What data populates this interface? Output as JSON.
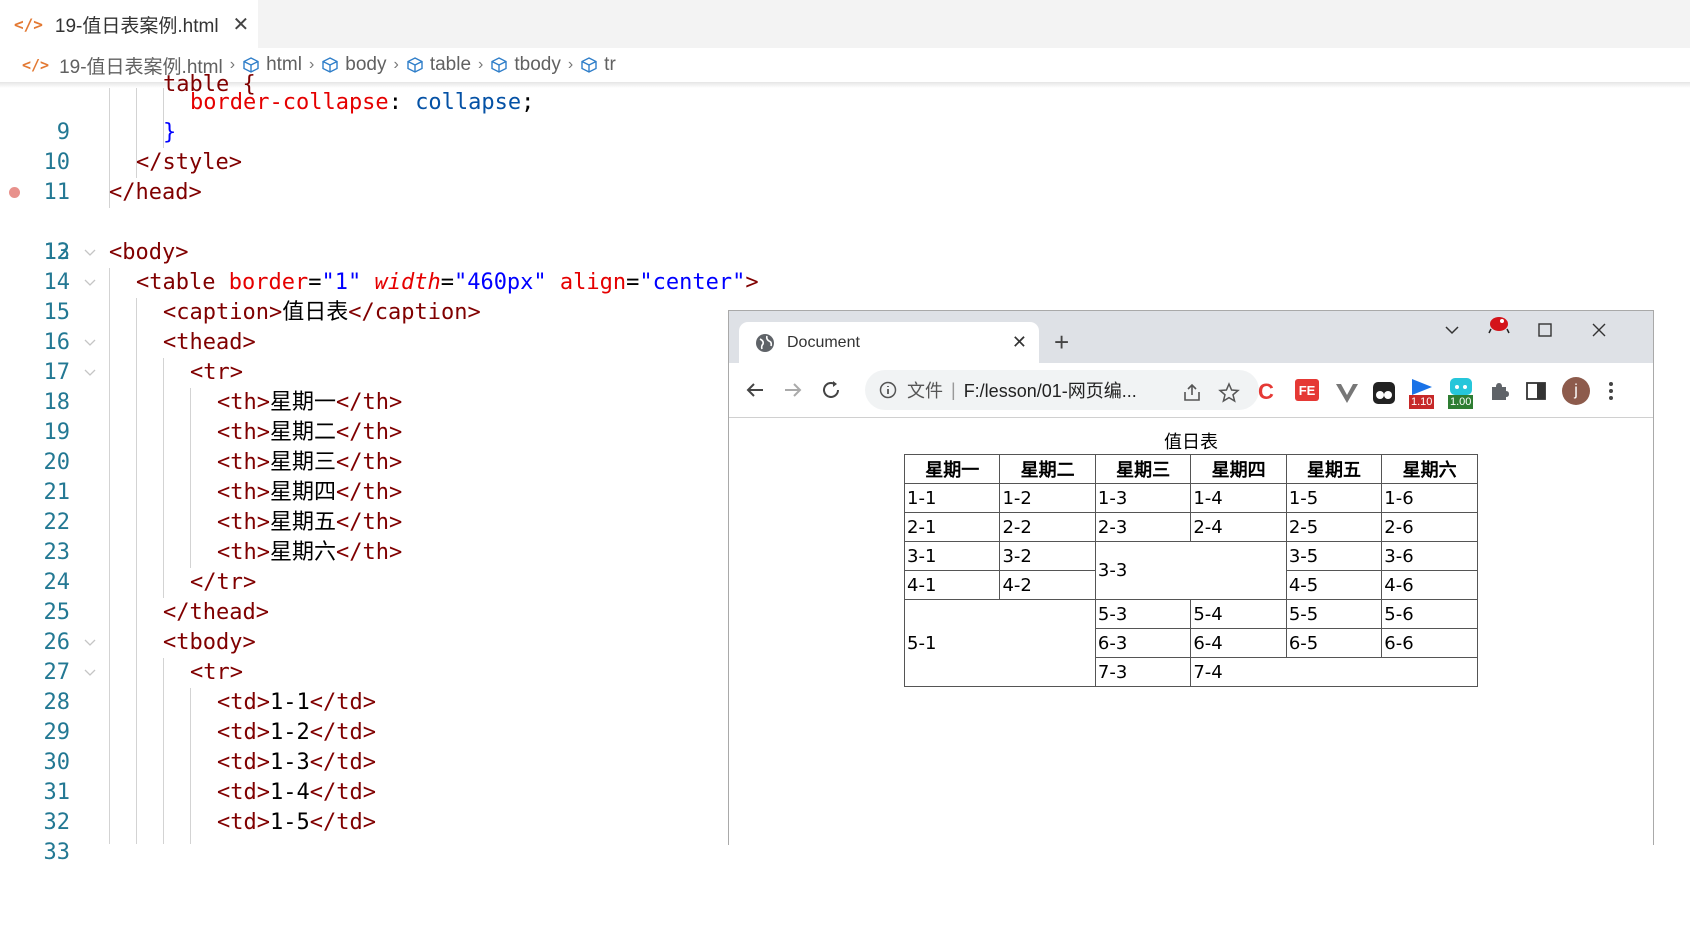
{
  "editor": {
    "tab": {
      "title": "19-值日表案例.html",
      "icon": "html-file-icon"
    },
    "breadcrumb": [
      "19-值日表案例.html",
      "html",
      "body",
      "table",
      "tbody",
      "tr"
    ],
    "gutter_numbers": [
      "9",
      "10",
      "11",
      "12",
      "13",
      "14",
      "15",
      "16",
      "17",
      "18",
      "19",
      "20",
      "21",
      "22",
      "23",
      "24",
      "25",
      "26",
      "27",
      "28",
      "29",
      "30",
      "31",
      "32",
      "33"
    ],
    "code": {
      "l9_prop": "border-collapse",
      "l9_colon": ": ",
      "l9_val": "collapse",
      "l9_semi": ";",
      "l10": "}",
      "l11": "</style>",
      "l12": "</head>",
      "l14": "<body>",
      "l15_open": "<table",
      "l15_a1": "border",
      "l15_eq": "=",
      "l15_v1": "\"1\"",
      "l15_a2": "width",
      "l15_v2": "\"460px\"",
      "l15_a3": "align",
      "l15_v3": "\"center\"",
      "l15_close": ">",
      "l16_open": "<caption>",
      "l16_text": "值日表",
      "l16_close": "</caption>",
      "l17": "<thead>",
      "l18": "<tr>",
      "th_open": "<th>",
      "th_close": "</th>",
      "th_texts": [
        "星期一",
        "星期二",
        "星期三",
        "星期四",
        "星期五",
        "星期六"
      ],
      "l25": "</tr>",
      "l26": "</thead>",
      "l27": "<tbody>",
      "l28": "<tr>",
      "td_open": "<td>",
      "td_close": "</td>",
      "td_texts": [
        "1-1",
        "1-2",
        "1-3",
        "1-4",
        "1-5"
      ]
    }
  },
  "browser": {
    "tab_title": "Document",
    "new_tab": "+",
    "omnibox": {
      "scheme": "文件",
      "pipe": "|",
      "url": "F:/lesson/01-网页编..."
    },
    "extensions": [
      {
        "name": "c-extension-icon",
        "label": "C"
      },
      {
        "name": "fe-extension-icon",
        "label": "FE"
      },
      {
        "name": "vue-devtools-icon",
        "label": ""
      },
      {
        "name": "tampermonkey-icon",
        "label": ""
      },
      {
        "name": "extension-1-10-icon",
        "badge": "1.10"
      },
      {
        "name": "extension-1-00-icon",
        "badge": "1.00"
      }
    ],
    "profile_initial": "j",
    "page": {
      "caption": "值日表",
      "headers": [
        "星期一",
        "星期二",
        "星期三",
        "星期四",
        "星期五",
        "星期六"
      ],
      "r1": [
        "1-1",
        "1-2",
        "1-3",
        "1-4",
        "1-5",
        "1-6"
      ],
      "r2": [
        "2-1",
        "2-2",
        "2-3",
        "2-4",
        "2-5",
        "2-6"
      ],
      "r3": [
        "3-1",
        "3-2",
        "3-3",
        "3-5",
        "3-6"
      ],
      "r4": [
        "4-1",
        "4-2",
        "4-5",
        "4-6"
      ],
      "r5": [
        "5-1",
        "5-3",
        "5-4",
        "5-5",
        "5-6"
      ],
      "r6": [
        "6-3",
        "6-4",
        "6-5",
        "6-6"
      ],
      "r7": [
        "7-3",
        "7-4"
      ]
    }
  },
  "colors": {
    "tag": "#800000",
    "attr": "#e50000",
    "string": "#0000ff",
    "value": "#0451a5",
    "line_number": "#237893"
  }
}
